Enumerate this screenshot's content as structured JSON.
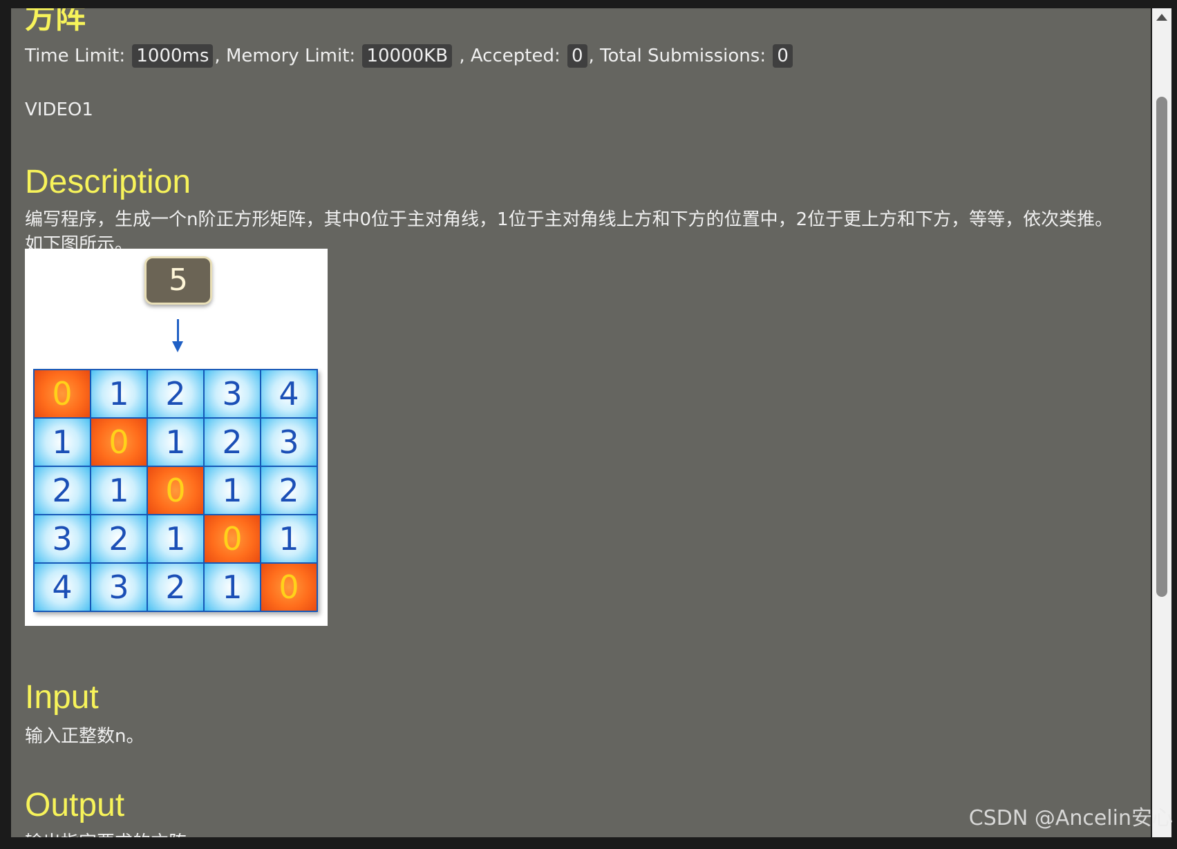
{
  "problem": {
    "title": "方阵",
    "meta": {
      "time_limit_label": "Time Limit:",
      "time_limit_value": "1000ms",
      "memory_limit_label": ", Memory Limit:",
      "memory_limit_value": "10000KB",
      "accepted_label": ", Accepted:",
      "accepted_value": "0",
      "total_submissions_label": ", Total Submissions:",
      "total_submissions_value": "0"
    },
    "video_label": "VIDEO1"
  },
  "description": {
    "heading": "Description",
    "text": "编写程序，生成一个n阶正方形矩阵，其中0位于主对角线，1位于主对角线上方和下方的位置中，2位于更上方和下方，等等，依次类推。如下图所示。",
    "figure": {
      "input_value": "5",
      "matrix": [
        [
          "0",
          "1",
          "2",
          "3",
          "4"
        ],
        [
          "1",
          "0",
          "1",
          "2",
          "3"
        ],
        [
          "2",
          "1",
          "0",
          "1",
          "2"
        ],
        [
          "3",
          "2",
          "1",
          "0",
          "1"
        ],
        [
          "4",
          "3",
          "2",
          "1",
          "0"
        ]
      ]
    }
  },
  "input": {
    "heading": "Input",
    "text": "输入正整数n。"
  },
  "output": {
    "heading": "Output",
    "text": "输出指定要求的方阵"
  },
  "watermark": "CSDN @Ancelin安心",
  "colors": {
    "page_background": "#656560",
    "heading_yellow": "#f7f35a",
    "body_text": "#f0f0f0",
    "matrix_blue": "#4cc1f3",
    "matrix_diagonal_orange": "#ff6d1c"
  }
}
